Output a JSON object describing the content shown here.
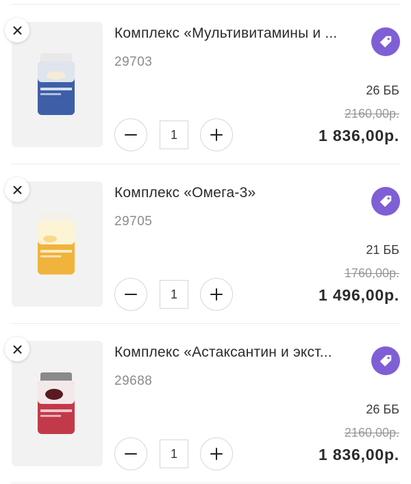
{
  "cart": {
    "items": [
      {
        "title": "Комплекс «Мультивитамины и ...",
        "code": "29703",
        "points": "26 ББ",
        "old_price": "2160,00р.",
        "price": "1 836,00р.",
        "quantity": "1",
        "jar_cap": "#ececec",
        "jar_body": "#3e5fa8",
        "jar_label": "#ffffff"
      },
      {
        "title": "Комплекс «Омега-3»",
        "code": "29705",
        "points": "21 ББ",
        "old_price": "1760,00р.",
        "price": "1 496,00р.",
        "quantity": "1",
        "jar_cap": "#f4f1e6",
        "jar_body": "#f0b43c",
        "jar_label": "#fdf4d6"
      },
      {
        "title": "Комплекс «Астаксантин и экст...",
        "code": "29688",
        "points": "26 ББ",
        "old_price": "2160,00р.",
        "price": "1 836,00р.",
        "quantity": "1",
        "jar_cap": "#8a8a8a",
        "jar_body": "#c23a4a",
        "jar_label": "#f4e9ea"
      }
    ]
  },
  "colors": {
    "promo_badge": "#7f5fd6",
    "divider": "#ececec"
  },
  "icons": {
    "remove": "close-icon",
    "promo": "tag-icon",
    "decrease": "minus-icon",
    "increase": "plus-icon"
  }
}
